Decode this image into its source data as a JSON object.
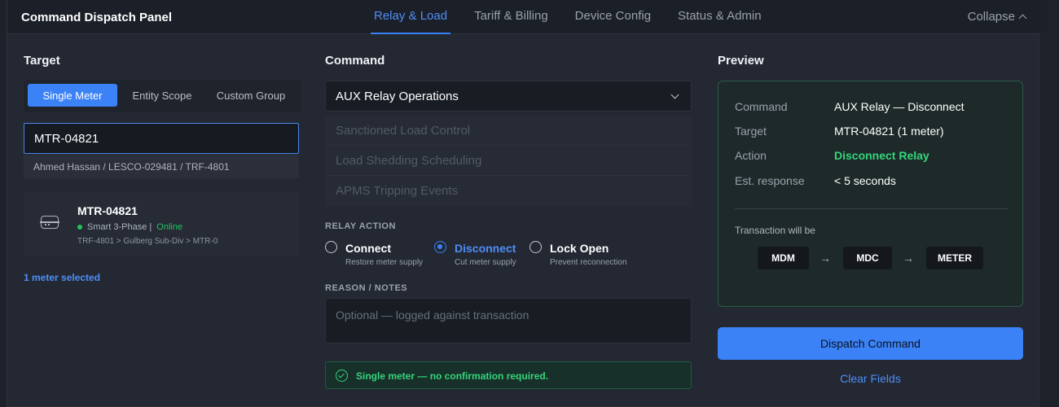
{
  "header": {
    "title": "Command Dispatch Panel",
    "tabs": [
      {
        "label": "Relay & Load",
        "active": true
      },
      {
        "label": "Tariff & Billing",
        "active": false
      },
      {
        "label": "Device Config",
        "active": false
      },
      {
        "label": "Status & Admin",
        "active": false
      }
    ],
    "collapse_label": "Collapse",
    "collapse_icon": "chevron-up-icon"
  },
  "target": {
    "title": "Target",
    "scope_options": [
      "Single Meter",
      "Entity Scope",
      "Custom Group"
    ],
    "scope_selected": "Single Meter",
    "search_value": "MTR-04821",
    "suggestion": "Ahmed Hassan / LESCO-029481 / TRF-4801",
    "meter": {
      "icon": "meter-icon",
      "id": "MTR-04821",
      "type": "Smart 3-Phase |",
      "status": "Online",
      "path": "TRF-4801 > Gulberg Sub-Div > MTR-0"
    },
    "selected_count": "1 meter selected"
  },
  "command": {
    "title": "Command",
    "selected": "AUX Relay Operations",
    "options": [
      "Sanctioned Load Control",
      "Load Shedding Scheduling",
      "APMS Tripping Events"
    ],
    "relay_action_label": "RELAY ACTION",
    "relay_actions": [
      {
        "label": "Connect",
        "sub": "Restore meter supply",
        "checked": false
      },
      {
        "label": "Disconnect",
        "sub": "Cut meter supply",
        "checked": true
      },
      {
        "label": "Lock Open",
        "sub": "Prevent reconnection",
        "checked": false
      }
    ],
    "notes_label": "REASON / NOTES",
    "notes_placeholder": "Optional — logged against transaction",
    "confirmation": "Single meter — no confirmation required."
  },
  "preview": {
    "title": "Preview",
    "rows": [
      {
        "key": "Command",
        "value": "AUX Relay — Disconnect"
      },
      {
        "key": "Target",
        "value": "MTR-04821 (1 meter)"
      },
      {
        "key": "Action",
        "value": "Disconnect Relay"
      },
      {
        "key": "Est. response",
        "value": "< 5 seconds"
      }
    ],
    "transaction_label": "Transaction will be",
    "flow": [
      "MDM",
      "MDC",
      "METER"
    ],
    "arrow": "→"
  },
  "actions": {
    "dispatch": "Dispatch Command",
    "clear": "Clear Fields"
  },
  "colors": {
    "accent": "#3b82f6",
    "success": "#34d57b",
    "background": "#232833"
  }
}
